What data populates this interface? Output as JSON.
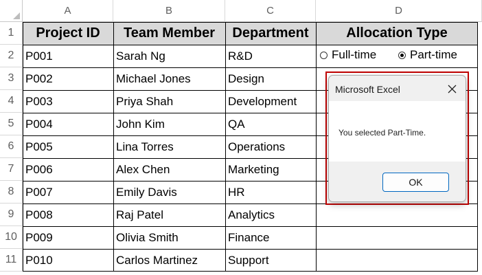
{
  "columns": [
    "A",
    "B",
    "C",
    "D"
  ],
  "rows": [
    "1",
    "2",
    "3",
    "4",
    "5",
    "6",
    "7",
    "8",
    "9",
    "10",
    "11"
  ],
  "headers": [
    "Project ID",
    "Team Member",
    "Department",
    "Allocation Type"
  ],
  "data": [
    [
      "P001",
      "Sarah Ng",
      "R&D"
    ],
    [
      "P002",
      "Michael Jones",
      "Design"
    ],
    [
      "P003",
      "Priya Shah",
      "Development"
    ],
    [
      "P004",
      "John Kim",
      "QA"
    ],
    [
      "P005",
      "Lina Torres",
      "Operations"
    ],
    [
      "P006",
      "Alex Chen",
      "Marketing"
    ],
    [
      "P007",
      "Emily Davis",
      "HR"
    ],
    [
      "P008",
      "Raj Patel",
      "Analytics"
    ],
    [
      "P009",
      "Olivia Smith",
      "Finance"
    ],
    [
      "P010",
      "Carlos Martinez",
      "Support"
    ]
  ],
  "radio": {
    "fulltime_label": "Full-time",
    "parttime_label": "Part-time",
    "selected": "Part-time"
  },
  "dialog": {
    "title": "Microsoft Excel",
    "message": "You selected Part-Time.",
    "ok_label": "OK"
  }
}
